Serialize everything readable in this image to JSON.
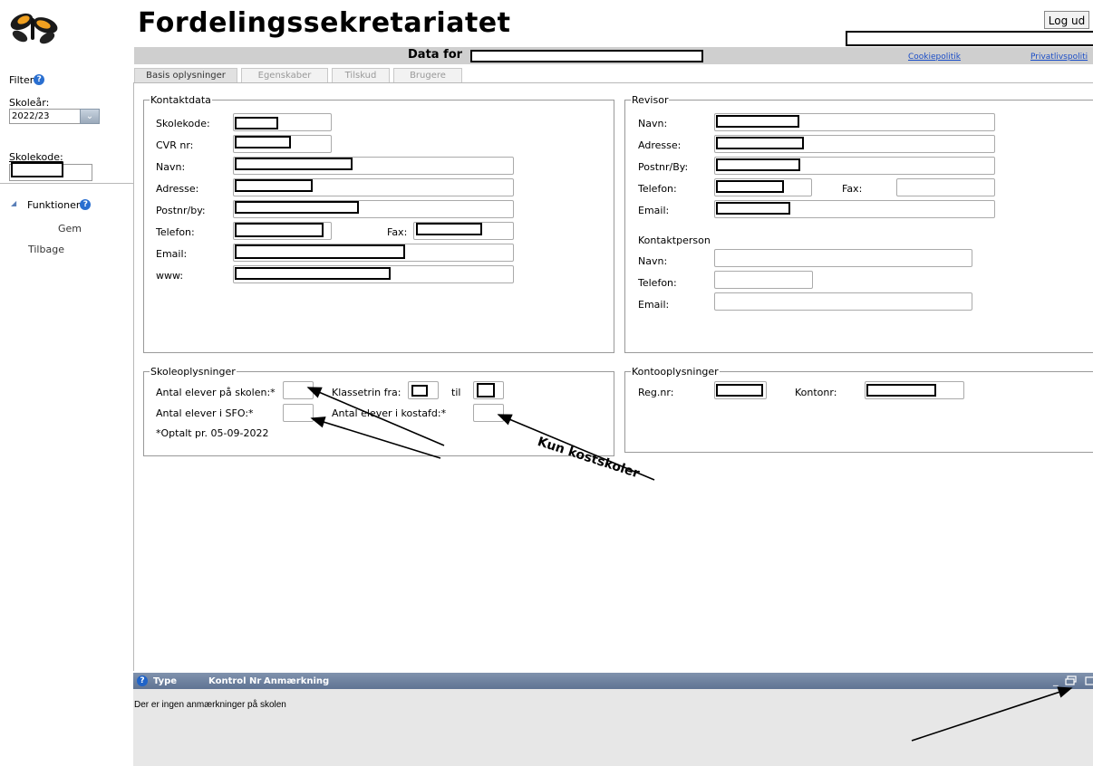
{
  "header": {
    "title": "Fordelingssekretariatet",
    "logout_label": "Log ud",
    "data_for_label": "Data for",
    "links": [
      "Cookiepolitik",
      "Privatlivspoliti"
    ]
  },
  "left_panel": {
    "filter_label": "Filter",
    "year_label": "Skoleår:",
    "year_value": "2022/23",
    "school_code_label": "Skolekode:",
    "functions_label": "Funktioner",
    "actions": [
      "Gem",
      "Tilbage"
    ]
  },
  "tabs": [
    "Basis oplysninger",
    "Egenskaber",
    "Tilskud",
    "Brugere"
  ],
  "contact": {
    "legend": "Kontaktdata",
    "labels": [
      "Skolekode:",
      "CVR nr:",
      "Navn:",
      "Adresse:",
      "Postnr/by:",
      "Telefon:",
      "Email:",
      "www:"
    ],
    "fax_label": "Fax:"
  },
  "revisor": {
    "legend": "Revisor",
    "labels": [
      "Navn:",
      "Adresse:",
      "Postnr/By:",
      "Telefon:",
      "Email:"
    ],
    "fax_label": "Fax:",
    "contact_person_title": "Kontaktperson",
    "contact_labels": [
      "Navn:",
      "Telefon:",
      "Email:"
    ]
  },
  "school_info": {
    "legend": "Skoleoplysninger",
    "students_label": "Antal elever på skolen:*",
    "grade_from_label": "Klassetrin fra:",
    "grade_to_label": "til",
    "sfo_label": "Antal elever i SFO:*",
    "boarding_label": "Antal elever i kostafd:*",
    "counted_note": "*Optalt pr. 05-09-2022"
  },
  "account_info": {
    "legend": "Kontooplysninger",
    "reg_label": "Reg.nr:",
    "account_label": "Kontonr:"
  },
  "remarks": {
    "col_type": "Type",
    "col_check": "Kontrol Nr",
    "col_remark": "Anmærkning",
    "empty_text": "Der er ingen anmærkninger på skolen"
  },
  "annotation": {
    "text": "Kun kostskoler"
  }
}
